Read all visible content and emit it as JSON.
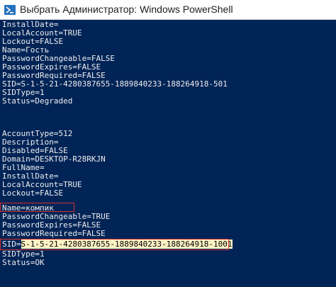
{
  "window": {
    "title": "Выбрать Администратор: Windows PowerShell"
  },
  "console": {
    "lines": [
      "InstallDate=",
      "LocalAccount=TRUE",
      "Lockout=FALSE",
      "Name=Гость",
      "PasswordChangeable=FALSE",
      "PasswordExpires=FALSE",
      "PasswordRequired=FALSE",
      "SID=S-1-5-21-4280387655-1889840233-188264918-501",
      "SIDType=1",
      "Status=Degraded",
      "",
      "",
      "AccountType=512",
      "Description=",
      "Disabled=FALSE",
      "Domain=DESKTOP-R28RKJN",
      "FullName=",
      "InstallDate=",
      "LocalAccount=TRUE",
      "Lockout=FALSE",
      "Name=компик",
      "PasswordChangeable=TRUE",
      "PasswordExpires=FALSE",
      "PasswordRequired=FALSE",
      "SID=",
      "SIDType=1",
      "Status=OK"
    ],
    "selected_sid": "S-1-5-21-4280387655-1889840233-188264918-1001"
  },
  "colors": {
    "console_background": "#012456",
    "console_text": "#eeedf0",
    "highlight_box": "#d32f2f",
    "selection": "#fdf2c4"
  },
  "icons": {
    "title": "powershell-icon"
  }
}
